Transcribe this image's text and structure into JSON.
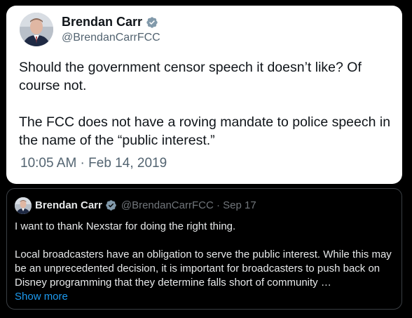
{
  "main_tweet": {
    "author_name": "Brendan Carr",
    "author_handle": "@BrendanCarrFCC",
    "paragraph_1": "Should the government censor speech it doesn’t like?  Of course not.",
    "paragraph_2": "The FCC does not have a roving mandate to police speech in the name of the “public interest.”",
    "timestamp": "10:05 AM · Feb 14, 2019",
    "verified_icon": "gray-verified-badge-icon"
  },
  "quoted_tweet": {
    "author_name": "Brendan Carr",
    "author_handle_date": "@BrendanCarrFCC · Sep 17",
    "paragraph_1": "I want to thank Nexstar for doing the right thing.",
    "paragraph_2": "Local broadcasters have an obligation to serve the public interest.  While this may be an unprecedented decision, it is important for broadcasters to push back on Disney programming that they determine falls short of community …",
    "show_more": "Show more",
    "verified_icon": "gray-verified-badge-icon"
  },
  "colors": {
    "badge_gray": "#829aab",
    "link_blue": "#1d9bf0",
    "background": "#000000"
  }
}
